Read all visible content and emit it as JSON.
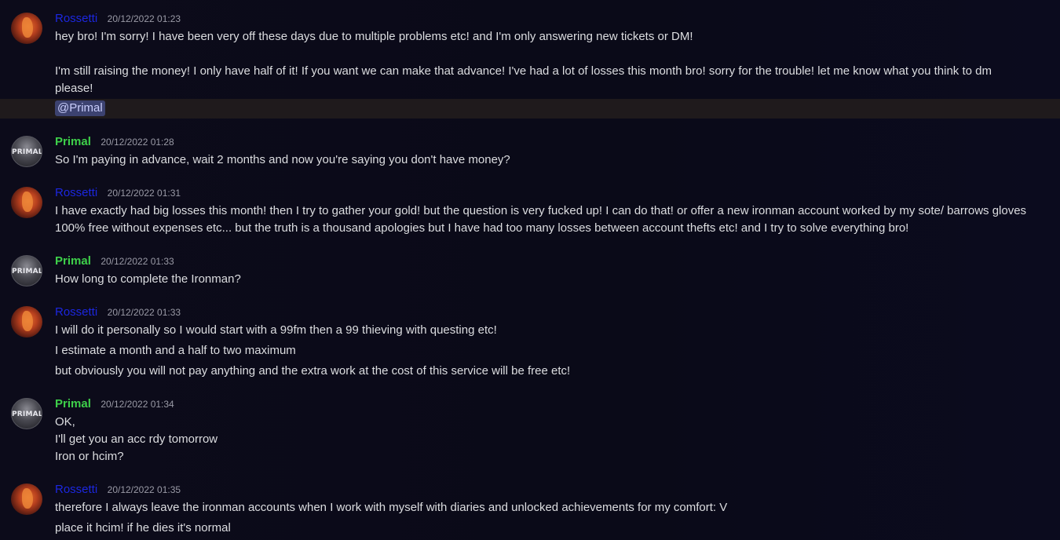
{
  "users": {
    "rossetti": "Rossetti",
    "primal": "Primal",
    "primal_avatar_text": "PRIMAL"
  },
  "messages": [
    {
      "author": "Rossetti",
      "time": "20/12/2022 01:23",
      "lines": [
        "hey bro! I'm sorry! I have been very off these days due to multiple problems etc! and I'm only answering new tickets or DM!",
        "I'm still raising the money! I only have half of it! If you want we can make that advance! I've had a lot of losses this month bro! sorry for the trouble! let me know what you think to dm please!"
      ],
      "mention": "@Primal"
    },
    {
      "author": "Primal",
      "time": "20/12/2022 01:28",
      "lines": [
        "So I'm paying in advance, wait 2 months and now you're saying you don't have money?"
      ]
    },
    {
      "author": "Rossetti",
      "time": "20/12/2022 01:31",
      "lines": [
        "I have exactly had big losses this month! then I try to gather your gold! but the question is very fucked up! I can do that! or offer a new ironman account worked by my sote/ barrows gloves 100% free without expenses etc... but the truth is a thousand apologies but I have had too many losses between account thefts etc! and I try to solve everything bro!"
      ]
    },
    {
      "author": "Primal",
      "time": "20/12/2022 01:33",
      "lines": [
        "How long to complete the Ironman?"
      ]
    },
    {
      "author": "Rossetti",
      "time": "20/12/2022 01:33",
      "lines": [
        "I will do it personally so I would start with a 99fm then a 99 thieving with questing etc!",
        "I estimate a month and a half to two maximum",
        "but obviously you will not pay anything and the extra work at the cost of this service will be free etc!"
      ]
    },
    {
      "author": "Primal",
      "time": "20/12/2022 01:34",
      "lines": [
        "OK,",
        "I'll get you an acc rdy tomorrow",
        "Iron or hcim?"
      ]
    },
    {
      "author": "Rossetti",
      "time": "20/12/2022 01:35",
      "lines": [
        "therefore I always leave the ironman accounts when I work with myself with diaries and unlocked achievements for my comfort: V",
        "place it hcim! if he dies it's normal"
      ]
    }
  ]
}
